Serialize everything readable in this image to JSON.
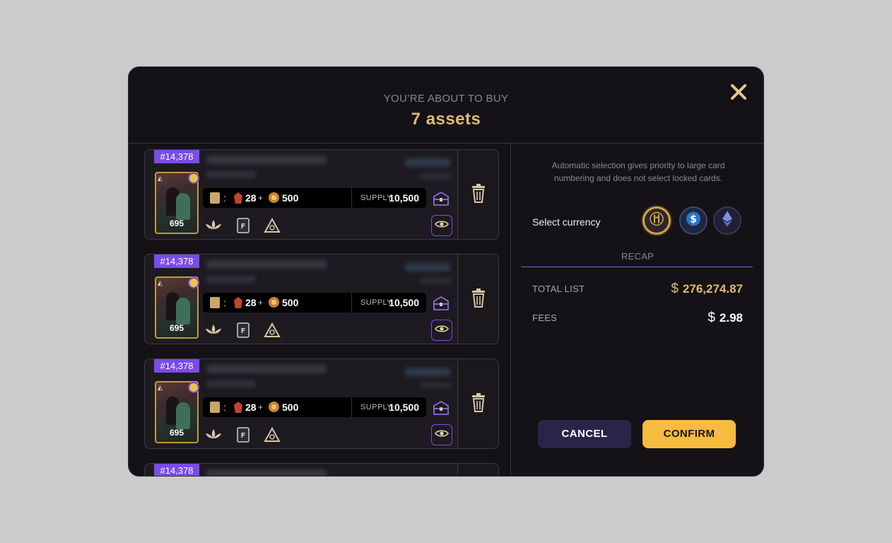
{
  "header": {
    "subtitle": "YOU’RE ABOUT TO BUY",
    "title": "7 assets"
  },
  "items": [
    {
      "badge": "#14,378",
      "card_number": "695",
      "cost_a": "28",
      "cost_b": "500",
      "supply_label": "SUPPLY",
      "supply_value": "10,500"
    },
    {
      "badge": "#14,378",
      "card_number": "695",
      "cost_a": "28",
      "cost_b": "500",
      "supply_label": "SUPPLY",
      "supply_value": "10,500"
    },
    {
      "badge": "#14,378",
      "card_number": "695",
      "cost_a": "28",
      "cost_b": "500",
      "supply_label": "SUPPLY",
      "supply_value": "10,500"
    },
    {
      "badge": "#14,378"
    }
  ],
  "panel": {
    "note": "Automatic selection gives priority to large card numbering and does not select locked cards.",
    "currency_label": "Select currency",
    "currencies": [
      "gold-token",
      "usdc",
      "ethereum"
    ],
    "recap_label": "RECAP",
    "total_label": "TOTAL LIST",
    "total_value": "276,274.87",
    "fees_label": "FEES",
    "fees_value": "2.98",
    "currency_symbol": "$"
  },
  "actions": {
    "cancel": "CANCEL",
    "confirm": "CONFIRM"
  },
  "colors": {
    "accent_gold": "#e4b873",
    "accent_purple": "#7a4ce8",
    "confirm_bg": "#f7bb3f",
    "cancel_bg": "#2a2448"
  }
}
